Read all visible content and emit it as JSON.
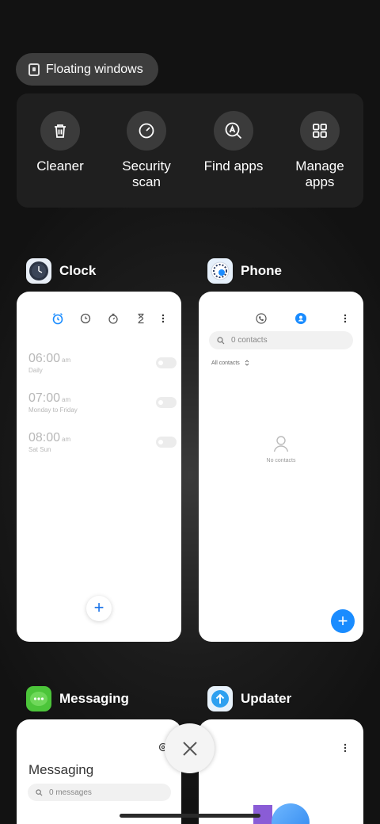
{
  "floating_windows": {
    "label": "Floating windows",
    "icon": "floating-window-icon"
  },
  "quick_actions": [
    {
      "label": "Cleaner",
      "icon": "trash-icon"
    },
    {
      "label": "Security\nscan",
      "icon": "security-scan-icon"
    },
    {
      "label": "Find apps",
      "icon": "find-apps-icon"
    },
    {
      "label": "Manage\napps",
      "icon": "grid-icon"
    }
  ],
  "apps": {
    "clock": {
      "name": "Clock",
      "tabs": [
        "alarm-icon",
        "world-clock-icon",
        "stopwatch-icon",
        "timer-icon"
      ],
      "alarms": [
        {
          "time": "06:00",
          "ampm": "am",
          "repeat": "Daily",
          "enabled": false
        },
        {
          "time": "07:00",
          "ampm": "am",
          "repeat": "Monday to Friday",
          "enabled": false
        },
        {
          "time": "08:00",
          "ampm": "am",
          "repeat": "Sat Sun",
          "enabled": false
        }
      ],
      "fab": "+"
    },
    "phone": {
      "name": "Phone",
      "search_placeholder": "0 contacts",
      "filter": "All contacts",
      "empty_text": "No contacts",
      "fab": "+"
    },
    "messaging": {
      "name": "Messaging",
      "title": "Messaging",
      "search_placeholder": "0 messages"
    },
    "updater": {
      "name": "Updater"
    }
  },
  "colors": {
    "accent": "#1a8cff",
    "background": "#121212"
  }
}
